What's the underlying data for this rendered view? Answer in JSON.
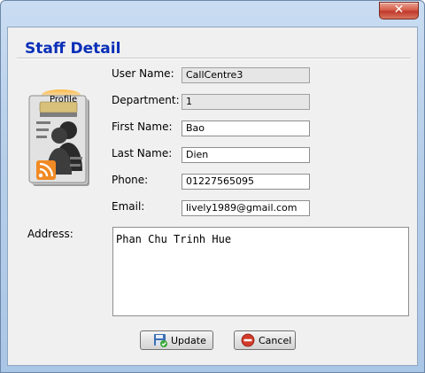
{
  "window": {
    "close_glyph": "✕"
  },
  "heading": "Staff Detail",
  "profile_card_label": "Profile",
  "fields": [
    {
      "label": "User Name:",
      "value": "CallCentre3",
      "readonly": true
    },
    {
      "label": "Department:",
      "value": "1",
      "readonly": true
    },
    {
      "label": "First Name:",
      "value": "Bao",
      "readonly": false
    },
    {
      "label": "Last Name:",
      "value": "Dien",
      "readonly": false
    },
    {
      "label": "Phone:",
      "value": "01227565095",
      "readonly": false
    },
    {
      "label": "Email:",
      "value": "lively1989@gmail.com",
      "readonly": false
    }
  ],
  "address": {
    "label": "Address:",
    "value": "Phan Chu Trinh Hue"
  },
  "buttons": {
    "update": "Update",
    "cancel": "Cancel"
  },
  "icons": {
    "close": "close-icon",
    "profile": "profile-card-icon",
    "update": "save-icon",
    "cancel": "cancel-icon"
  },
  "colors": {
    "heading": "#0a2fb8",
    "close_button": "#c0392b"
  }
}
